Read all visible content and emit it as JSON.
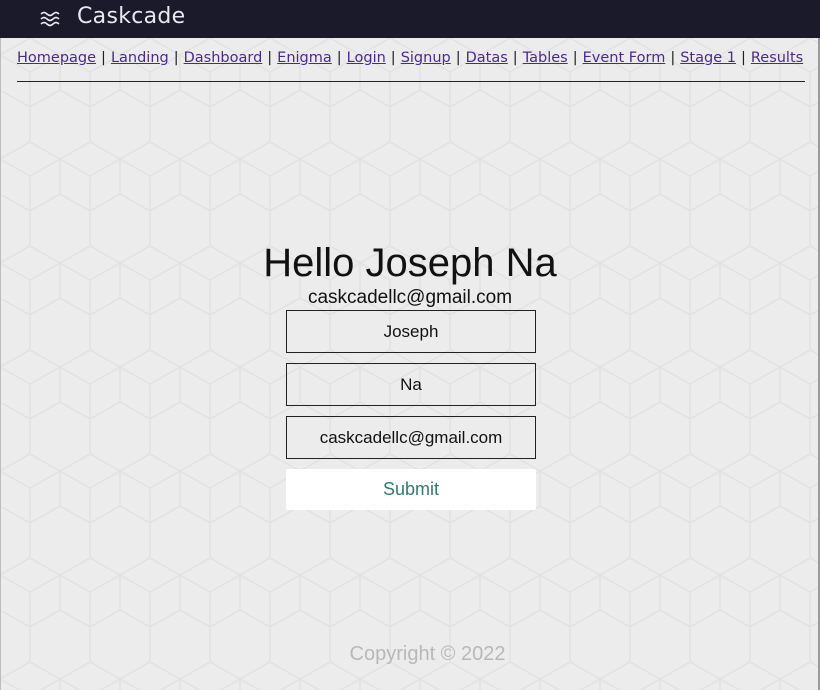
{
  "brand": {
    "icon": "waves-icon",
    "name": "Caskcade"
  },
  "nav": {
    "links": [
      "Homepage",
      "Landing",
      "Dashboard",
      "Enigma",
      "Login",
      "Signup",
      "Datas",
      "Tables",
      "Event Form",
      "Stage 1",
      "Results"
    ],
    "separator": "|"
  },
  "profile": {
    "greeting": "Hello Joseph Na",
    "email": "caskcadellc@gmail.com"
  },
  "form": {
    "first_name": "Joseph",
    "last_name": "Na",
    "email": "caskcadellc@gmail.com",
    "submit_label": "Submit"
  },
  "footer": {
    "copyright": "Copyright © 2022"
  },
  "colors": {
    "topbar": "#1b1a2b",
    "link": "#4a2a8c",
    "submit_text": "#2e7d6e",
    "background": "#ececec"
  }
}
